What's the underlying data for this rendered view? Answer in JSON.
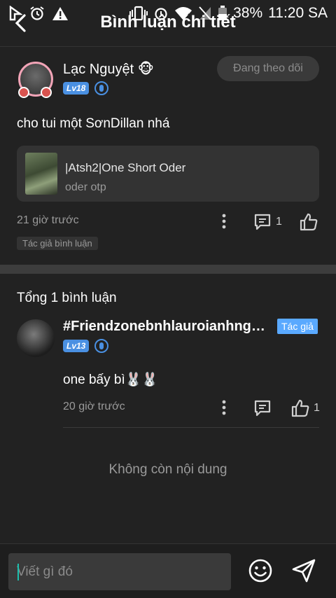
{
  "status_bar": {
    "battery": "38%",
    "time": "11:20 SA"
  },
  "header": {
    "title": "Bình luận chi tiết"
  },
  "main_comment": {
    "username": "Lạc Nguyệt 🐵",
    "level": "Lv18",
    "follow_label": "Đang theo dõi",
    "text": "cho tui một SơnDillan nhá",
    "link_card": {
      "title": "|Atsh2|One Short Oder",
      "subtitle": "oder otp"
    },
    "time": "21 giờ trước",
    "reply_count": "1",
    "author_tag": "Tác giả bình luận"
  },
  "replies_section": {
    "total": "Tổng 1 bình luận",
    "reply": {
      "username": "#Friendzonebnhlauroianhnghi...",
      "author_badge": "Tác giả",
      "level": "Lv13",
      "text": "one bấy bì🐰🐰",
      "time": "20 giờ trước",
      "like_count": "1"
    },
    "end_text": "Không còn nội dung"
  },
  "input": {
    "placeholder": "Viết gì đó"
  },
  "colors": {
    "background": "#222222",
    "accent_blue": "#4a90e2",
    "author_badge": "#5aa9ff",
    "cursor": "#1cbfae"
  }
}
